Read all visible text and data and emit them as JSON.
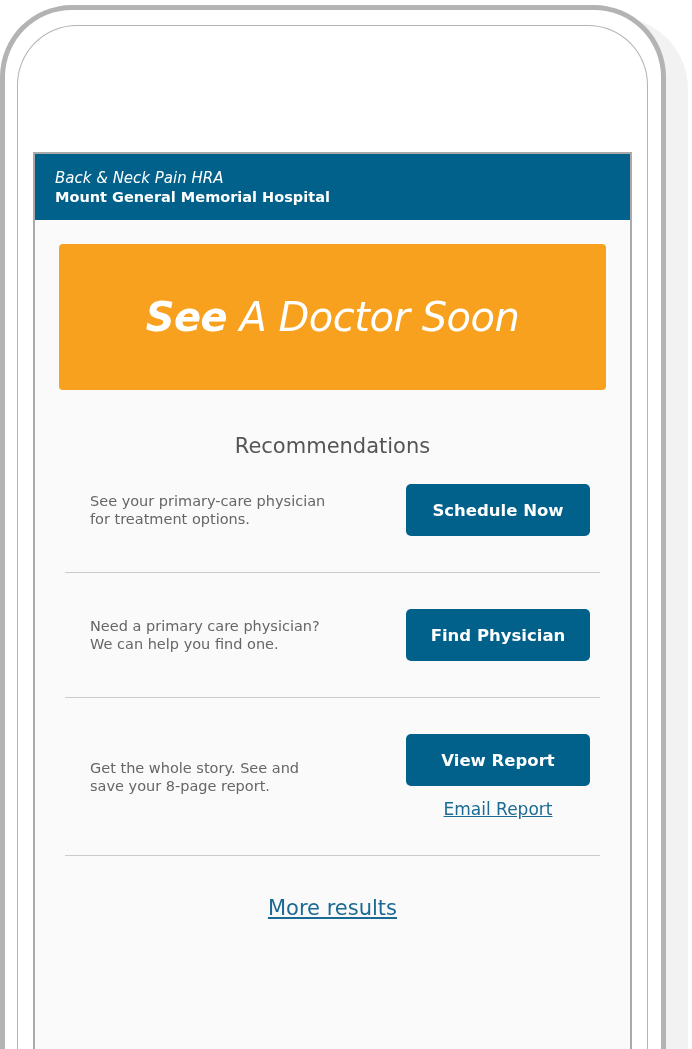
{
  "header": {
    "subtitle": "Back & Neck Pain HRA",
    "title": "Mount General Memorial Hospital"
  },
  "banner": {
    "text": "**See** A Doctor Soon"
  },
  "section_title": "Recommendations",
  "recommendations": [
    {
      "text": "See your primary-care physician for treatment options.",
      "button": "Schedule Now"
    },
    {
      "text": "Need a primary care physician? We can help you find one.",
      "button": "Find Physician"
    },
    {
      "text": "Get the whole story. See and save your 8-page report.",
      "button": "View Report",
      "link": "Email Report"
    }
  ],
  "more_link": "More results"
}
